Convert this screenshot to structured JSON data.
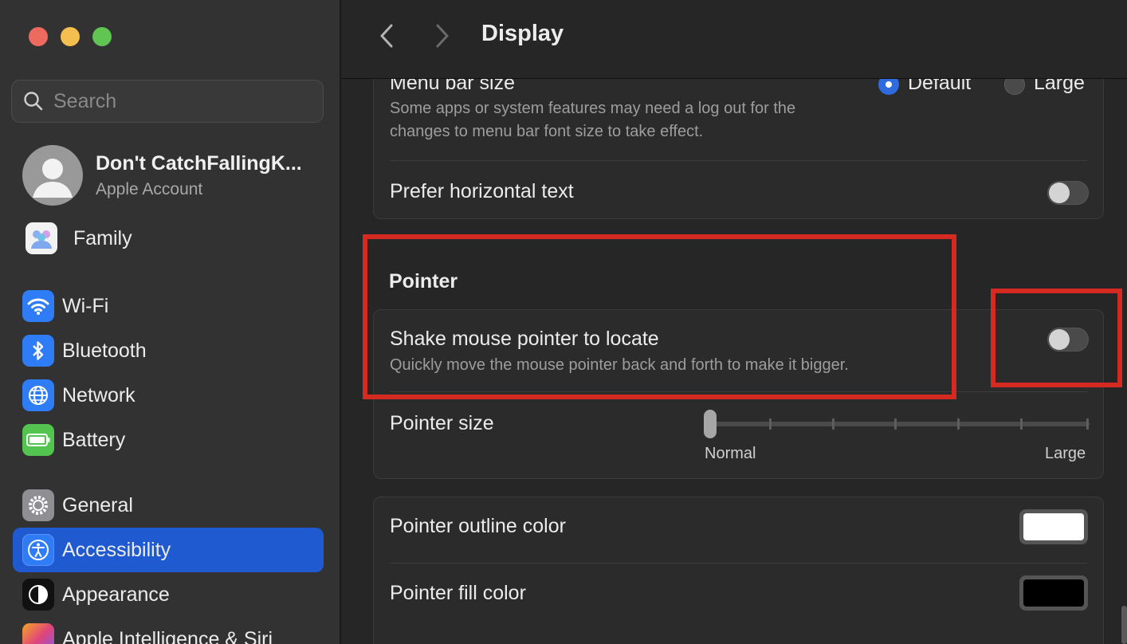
{
  "window": {
    "title": "Display"
  },
  "search": {
    "placeholder": "Search"
  },
  "account": {
    "name": "Don't CatchFallingK...",
    "subtitle": "Apple Account"
  },
  "sidebar": {
    "family": "Family",
    "items": [
      {
        "label": "Wi-Fi",
        "icon": "wifi-icon",
        "color": "#2f7df6"
      },
      {
        "label": "Bluetooth",
        "icon": "bluetooth-icon",
        "color": "#2f7df6"
      },
      {
        "label": "Network",
        "icon": "globe-icon",
        "color": "#2f7df6"
      },
      {
        "label": "Battery",
        "icon": "battery-icon",
        "color": "#52c44f"
      },
      {
        "label": "General",
        "icon": "gear-icon",
        "color": "#8e8e93"
      },
      {
        "label": "Accessibility",
        "icon": "accessibility-icon",
        "color": "#2f7df6",
        "active": true
      },
      {
        "label": "Appearance",
        "icon": "appearance-icon",
        "color": "#111111"
      },
      {
        "label": "Apple Intelligence & Siri",
        "icon": "siri-icon",
        "color": "#e0457b"
      }
    ]
  },
  "display": {
    "menu_bar_size": {
      "title": "Menu bar size",
      "description": "Some apps or system features may need a log out for the changes to menu bar font size to take effect.",
      "options": [
        "Default",
        "Large"
      ],
      "selected": "Default"
    },
    "prefer_horizontal_text": {
      "label": "Prefer horizontal text",
      "enabled": false
    }
  },
  "pointer": {
    "section_title": "Pointer",
    "shake_to_locate": {
      "title": "Shake mouse pointer to locate",
      "description": "Quickly move the mouse pointer back and forth to make it bigger.",
      "enabled": false
    },
    "pointer_size": {
      "title": "Pointer size",
      "min_label": "Normal",
      "max_label": "Large",
      "value": 0
    },
    "outline_color": {
      "label": "Pointer outline color",
      "color": "#ffffff"
    },
    "fill_color": {
      "label": "Pointer fill color",
      "color": "#000000"
    }
  },
  "colors": {
    "accent": "#1f5ad1",
    "highlight": "#d42a22"
  }
}
